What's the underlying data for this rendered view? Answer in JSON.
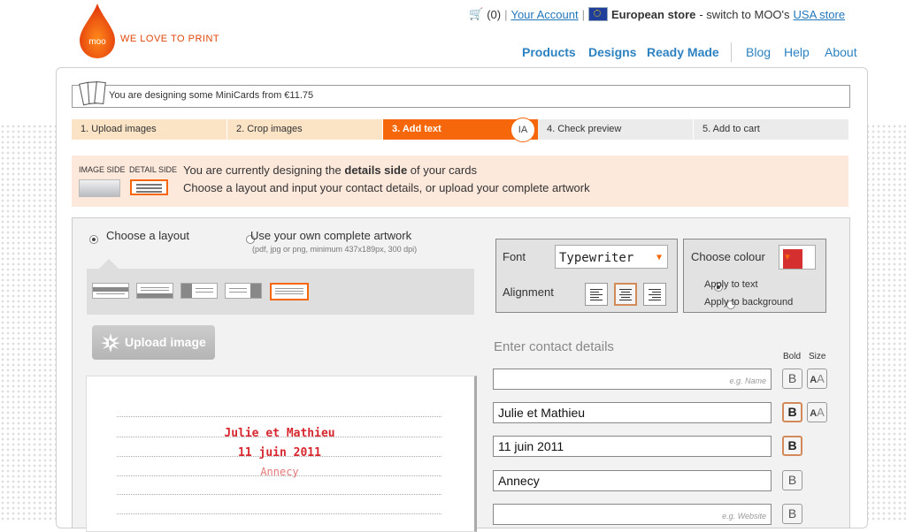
{
  "header": {
    "tagline": "WE LOVE TO PRINT",
    "logo_text": "moo",
    "cart": "(0)",
    "separator": "|",
    "your_account": "Your Account",
    "store_label": "European store",
    "store_switch": "- switch to MOO's",
    "usa_store": "USA store",
    "nav_main": [
      "Products",
      "Designs",
      "Ready Made"
    ],
    "nav_secondary": [
      "Blog",
      "Help",
      "About"
    ]
  },
  "banner": {
    "text": "You are designing some MiniCards from €11.75"
  },
  "steps": [
    {
      "label": "1. Upload images",
      "state": "done"
    },
    {
      "label": "2. Crop images",
      "state": "done"
    },
    {
      "label": "3. Add text",
      "state": "active"
    },
    {
      "label": "4. Check preview",
      "state": "todo"
    },
    {
      "label": "5. Add to cart",
      "state": "todo"
    }
  ],
  "cursor_label": "IA",
  "info": {
    "image_side": "IMAGE SIDE",
    "detail_side": "DETAIL SIDE",
    "line1_pre": "You are currently designing the ",
    "line1_bold": "details side",
    "line1_post": " of your cards",
    "line2": "Choose a layout and input your contact details, or upload your complete artwork"
  },
  "layout_options": {
    "choose_layout": "Choose a layout",
    "own_artwork": "Use your own complete artwork",
    "own_artwork_note": "(pdf, jpg or png, minimum 437x189px, 300 dpi)",
    "selected": "choose_layout"
  },
  "upload_button": "Upload image",
  "font_panel": {
    "font_label": "Font",
    "font_value": "Typewriter",
    "alignment_label": "Alignment",
    "alignment_selected": "center"
  },
  "colour_panel": {
    "label": "Choose colour",
    "swatch": "#d62f2f",
    "apply_text": "Apply to text",
    "apply_background": "Apply to background",
    "selected": "text"
  },
  "contact": {
    "title": "Enter contact details",
    "bold_header": "Bold",
    "size_header": "Size",
    "bold_glyph": "B",
    "size_big": "A",
    "size_small": "A",
    "fields": [
      {
        "value": "",
        "placeholder": "e.g. Name",
        "bold": false
      },
      {
        "value": "Julie et Mathieu",
        "placeholder": "",
        "bold": true
      },
      {
        "value": "11 juin 2011",
        "placeholder": "",
        "bold": true
      },
      {
        "value": "Annecy",
        "placeholder": "",
        "bold": false
      },
      {
        "value": "",
        "placeholder": "e.g. Website",
        "bold": false
      }
    ]
  },
  "preview": {
    "lines": [
      "Julie et Mathieu",
      "11 juin 2011",
      "Annecy"
    ]
  },
  "colors": {
    "accent": "#f5670a",
    "link": "#2d82c1",
    "text_red": "#d7262e"
  }
}
